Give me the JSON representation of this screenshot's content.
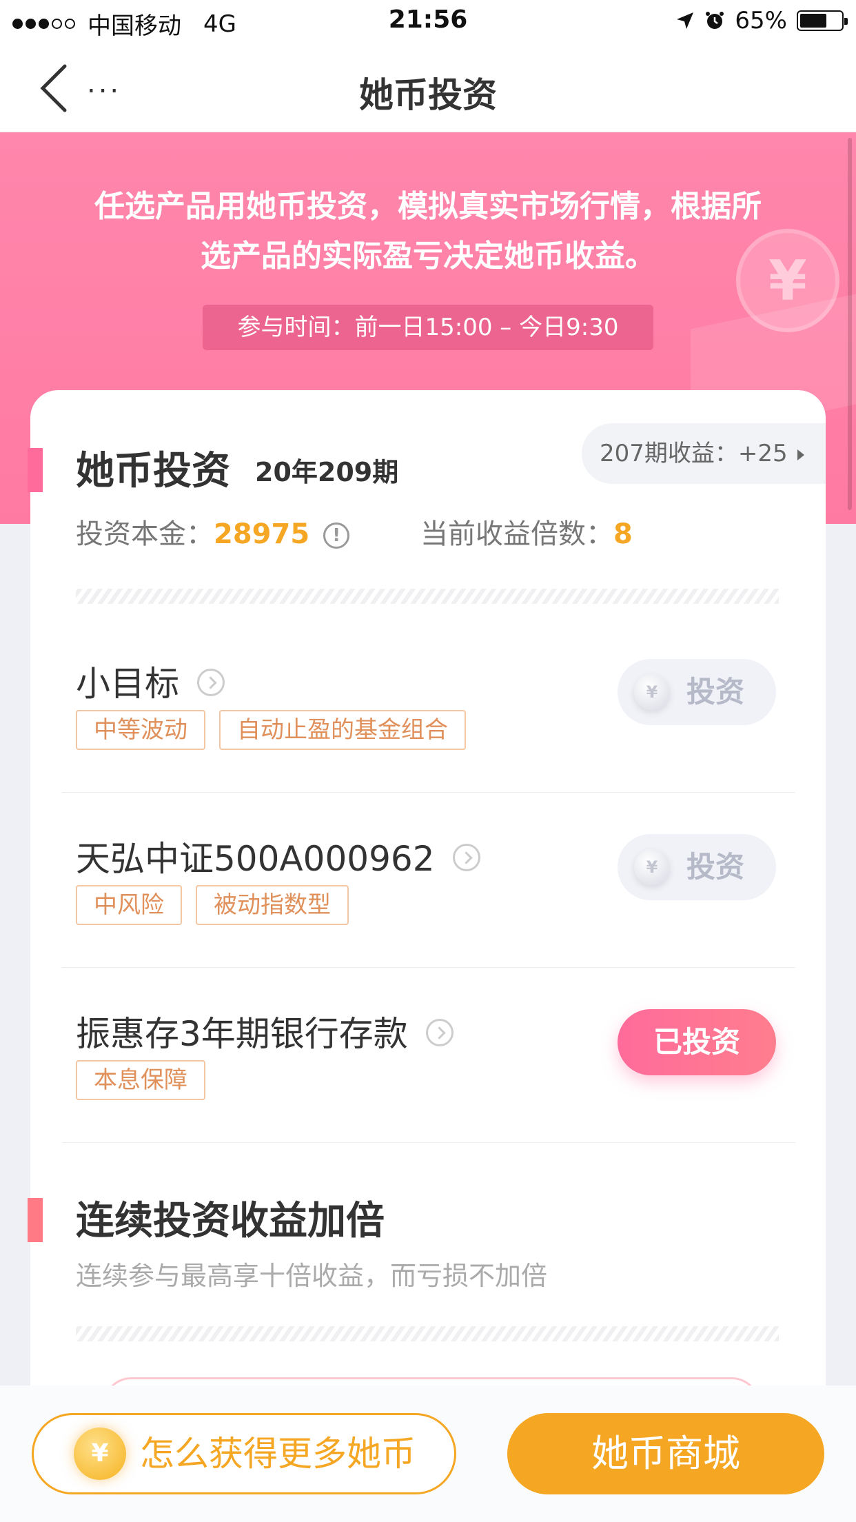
{
  "status_bar": {
    "carrier": "中国移动",
    "network": "4G",
    "time": "21:56",
    "battery": "65%",
    "battery_level": 0.65
  },
  "nav": {
    "title": "她币投资",
    "more": "..."
  },
  "banner": {
    "line1": "任选产品用她币投资，模拟真实市场行情，根据所",
    "line2": "选产品的实际盈亏决定她币收益。",
    "time_range": "参与时间：前一日15:00 – 今日9:30",
    "deco_coin": "¥"
  },
  "invest_section": {
    "title": "她币投资",
    "period": "20年209期",
    "prev_profit": "207期收益：+25",
    "principal_label": "投资本金：",
    "principal_value": "28975",
    "multiplier_label": "当前收益倍数：",
    "multiplier_value": "8"
  },
  "products": [
    {
      "name": "小目标",
      "tags": [
        "中等波动",
        "自动止盈的基金组合"
      ],
      "button": "投资",
      "coin": "¥"
    },
    {
      "name": "天弘中证500A000962",
      "tags": [
        "中风险",
        "被动指数型"
      ],
      "button": "投资",
      "coin": "¥"
    },
    {
      "name": "振惠存3年期银行存款",
      "tags": [
        "本息保障"
      ],
      "button": "已投资"
    }
  ],
  "double_section": {
    "title": "连续投资收益加倍",
    "subtitle": "连续参与最高享十倍收益，而亏损不加倍"
  },
  "bottom": {
    "earn_button": "怎么获得更多她币",
    "earn_coin": "¥",
    "mall_button": "她币商城"
  }
}
